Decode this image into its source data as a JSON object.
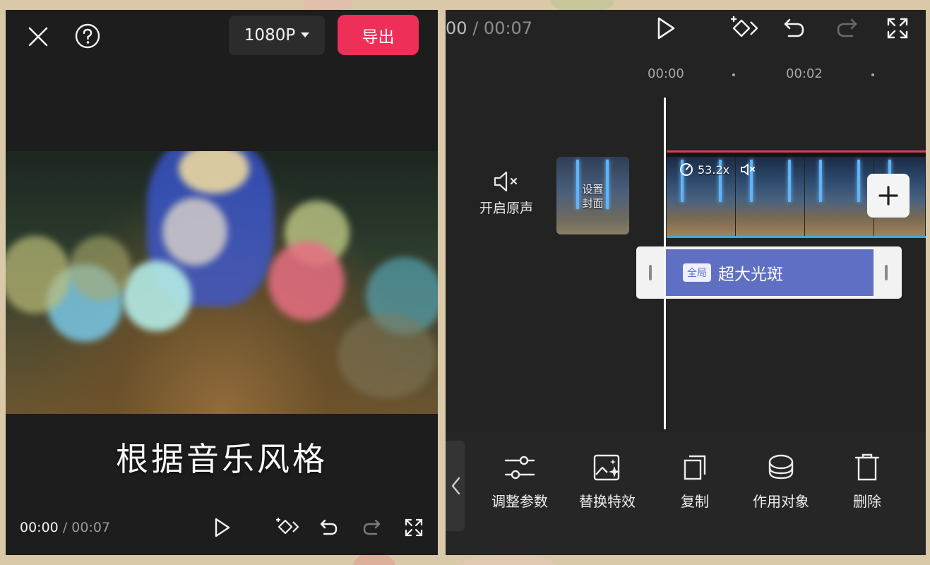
{
  "left_panel": {
    "resolution_label": "1080P",
    "export_label": "导出",
    "subtitle": "根据音乐风格",
    "time_current": "00:00",
    "time_separator": "/",
    "time_total": "00:07"
  },
  "right_panel": {
    "time_current": "00",
    "time_separator": "/",
    "time_total": "00:07",
    "ruler": {
      "labels": [
        "00:00",
        "00:02"
      ]
    },
    "audio_toggle_label": "开启原声",
    "cover_label_line1": "设置",
    "cover_label_line2": "封面",
    "clip_speed": "53.2x",
    "effect_badge": "全局",
    "effect_name": "超大光斑",
    "toolbar": [
      {
        "label": "调整参数",
        "icon": "sliders-icon"
      },
      {
        "label": "替换特效",
        "icon": "replace-effect-icon"
      },
      {
        "label": "复制",
        "icon": "copy-icon"
      },
      {
        "label": "作用对象",
        "icon": "layers-icon"
      },
      {
        "label": "删除",
        "icon": "trash-icon"
      }
    ]
  },
  "colors": {
    "export_button": "#ee2f57",
    "effect_track": "#5f6fc3",
    "video_track_top": "#e23a5b",
    "video_track_bottom": "#3fa8d8"
  }
}
